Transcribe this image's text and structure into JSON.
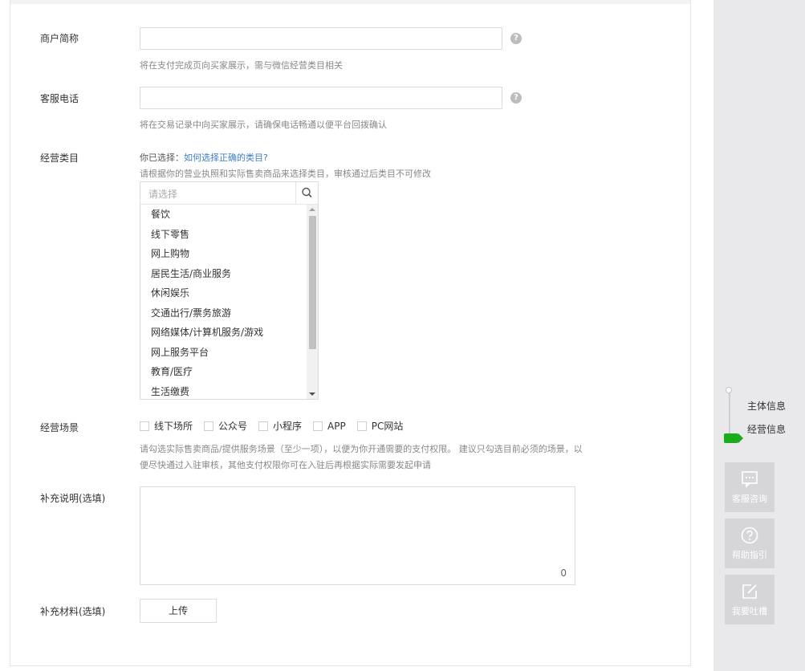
{
  "form": {
    "merchant_name": {
      "label": "商户简称",
      "help": "?",
      "hint": "将在支付完成页向买家展示，需与微信经营类目相关"
    },
    "service_phone": {
      "label": "客服电话",
      "help": "?",
      "hint": "将在交易记录中向买家展示，请确保电话畅通以便平台回拨确认"
    },
    "business_category": {
      "label": "经营类目",
      "selected_prefix": "你已选择：",
      "guide_link": "如何选择正确的类目?",
      "hint": "请根据你的营业执照和实际售卖商品来选择类目，审核通过后类目不可修改",
      "search_placeholder": "请选择",
      "options": [
        "餐饮",
        "线下零售",
        "网上购物",
        "居民生活/商业服务",
        "休闲娱乐",
        "交通出行/票务旅游",
        "网络媒体/计算机服务/游戏",
        "网上服务平台",
        "教育/医疗",
        "生活缴费"
      ]
    },
    "business_scene": {
      "label": "经营场景",
      "options": [
        "线下场所",
        "公众号",
        "小程序",
        "APP",
        "PC网站"
      ],
      "hint_line1": "请勾选实际售卖商品/提供服务场景（至少一项），以便为你开通需要的支付权限。 建议只勾选目前必须的场景，以",
      "hint_line2": "便尽快通过入驻审核，其他支付权限你可在入驻后再根据实际需要发起申请"
    },
    "supplement_note": {
      "label": "补充说明(选填)",
      "char_count": "0"
    },
    "supplement_material": {
      "label": "补充材料(选填)",
      "upload_label": "上传"
    }
  },
  "side": {
    "steps": [
      "主体信息",
      "经营信息"
    ],
    "active_step_color": "#1aad19",
    "tiles": [
      {
        "label": "客服咨询",
        "icon": "chat-icon"
      },
      {
        "label": "帮助指引",
        "icon": "question-circle-icon"
      },
      {
        "label": "我要吐槽",
        "icon": "edit-icon"
      }
    ]
  }
}
